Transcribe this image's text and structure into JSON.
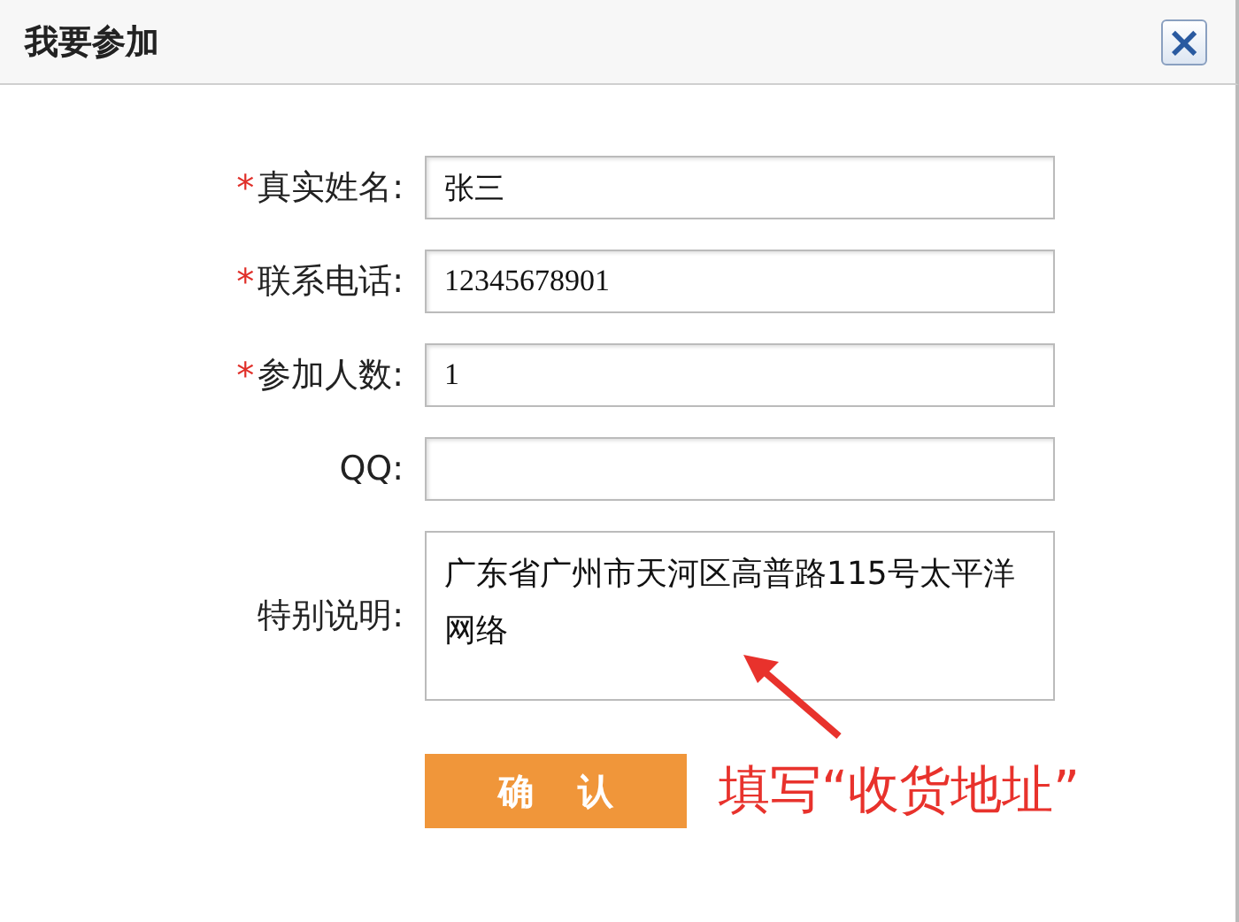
{
  "dialog": {
    "title": "我要参加",
    "close": "×"
  },
  "fields": [
    {
      "label": "真实姓名:",
      "required": true,
      "kind": "input",
      "value": "张三"
    },
    {
      "label": "联系电话:",
      "required": true,
      "kind": "input",
      "value": "12345678901"
    },
    {
      "label": "参加人数:",
      "required": true,
      "kind": "input",
      "value": "1"
    },
    {
      "label": "QQ:",
      "required": false,
      "kind": "input"
    },
    {
      "label": "特别说明:",
      "required": false,
      "kind": "textarea",
      "value": "广东省广州市天河区高普路115号太平洋网络"
    }
  ],
  "required_mark": "*",
  "submit": "确 认",
  "annotation": "填写“收货地址”"
}
